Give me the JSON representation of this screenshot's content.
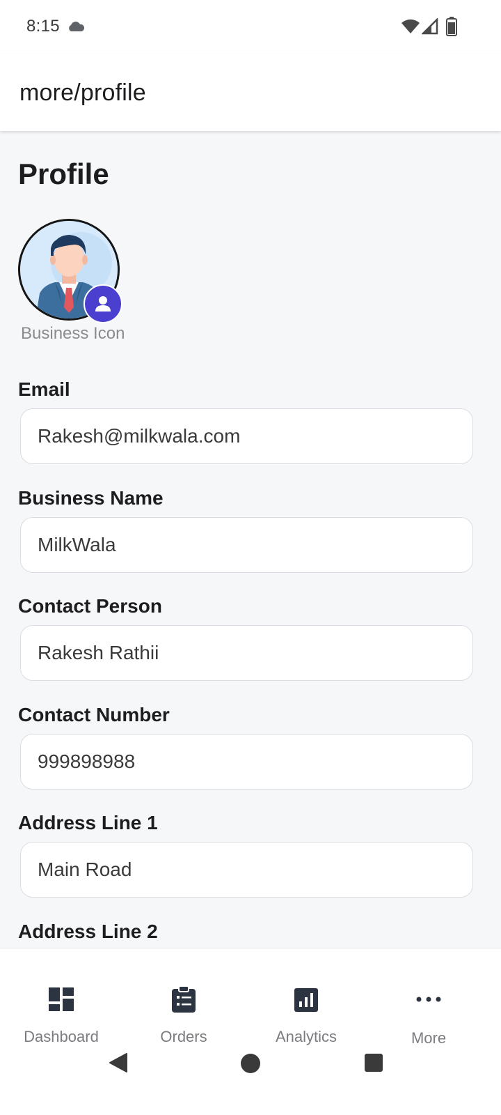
{
  "status_bar": {
    "time": "8:15"
  },
  "app_bar": {
    "title": "more/profile"
  },
  "profile": {
    "page_title": "Profile",
    "avatar_caption": "Business Icon"
  },
  "fields": {
    "email": {
      "label": "Email",
      "value": "Rakesh@milkwala.com"
    },
    "business_name": {
      "label": "Business Name",
      "value": "MilkWala"
    },
    "contact_person": {
      "label": "Contact Person",
      "value": "Rakesh Rathii"
    },
    "contact_number": {
      "label": "Contact Number",
      "value": "999898988"
    },
    "address_line_1": {
      "label": "Address Line 1",
      "value": "Main Road"
    },
    "address_line_2": {
      "label": "Address Line 2"
    }
  },
  "bottom_nav": {
    "items": [
      {
        "label": "Dashboard",
        "icon": "dashboard-icon"
      },
      {
        "label": "Orders",
        "icon": "clipboard-list-icon"
      },
      {
        "label": "Analytics",
        "icon": "bar-chart-icon"
      },
      {
        "label": "More",
        "icon": "more-dots-icon"
      }
    ]
  },
  "colors": {
    "accent": "#4a3fcf",
    "background": "#f6f7f9",
    "nav_icon": "#2b3440"
  }
}
